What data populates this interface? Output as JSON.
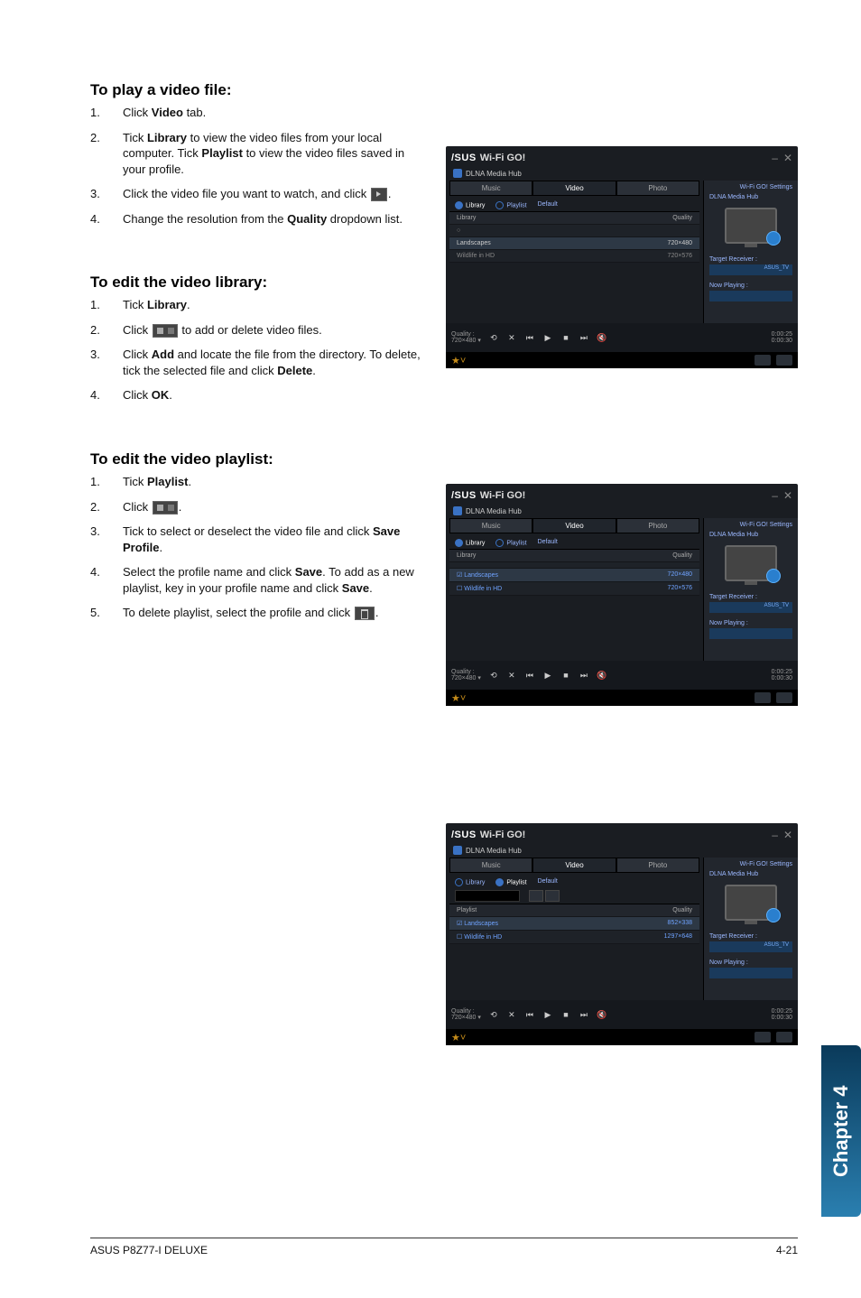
{
  "sections": {
    "play_video": {
      "title": "To play a video file:",
      "steps": [
        {
          "n": "1.",
          "t": "Click <b>Video</b> tab."
        },
        {
          "n": "2.",
          "t": "Tick <b>Library</b> to view the video files from your local computer. Tick <b>Playlist</b> to view the video files saved in your profile."
        },
        {
          "n": "3.",
          "t": "Click the video file you want to watch, and click <span class='inline-icon play' data-name='play-icon' data-interactable='false'></span>."
        },
        {
          "n": "4.",
          "t": "Change the resolution from the <b>Quality</b> dropdown list."
        }
      ]
    },
    "edit_library": {
      "title": "To edit the video library:",
      "steps": [
        {
          "n": "1.",
          "t": "Tick <b>Library</b>."
        },
        {
          "n": "2.",
          "t": "Click <span class='inline-icon wide' data-name='library-edit-icon' data-interactable='false'></span> to add or delete video files."
        },
        {
          "n": "3.",
          "t": "Click <b>Add</b> and locate the file from the directory. To delete, tick the selected file and click <b>Delete</b>."
        },
        {
          "n": "4.",
          "t": "Click <b>OK</b>."
        }
      ]
    },
    "edit_playlist": {
      "title": "To edit the video playlist:",
      "steps": [
        {
          "n": "1.",
          "t": "Tick <b>Playlist</b>."
        },
        {
          "n": "2.",
          "t": "Click <span class='inline-icon wide' data-name='playlist-edit-icon' data-interactable='false'></span>."
        },
        {
          "n": "3.",
          "t": "Tick to select or deselect the video file and click <b>Save Profile</b>."
        },
        {
          "n": "4.",
          "t": "Select the profile name and click <b>Save</b>. To add as a new playlist, key in your profile name and click <b>Save</b>."
        },
        {
          "n": "5.",
          "t": "To delete playlist, select the profile and click <span class='inline-icon trash' data-name='trash-icon' data-interactable='false'></span>."
        }
      ]
    }
  },
  "shot_common": {
    "brand": "/SUS",
    "app": "Wi-Fi GO!",
    "sub": "DLNA Media Hub",
    "settings": "Wi-Fi GO! Settings",
    "hub": "DLNA Media Hub",
    "target": "Target Receiver :",
    "target_val": "ASUS_TV",
    "now": "Now Playing :",
    "tabs": [
      "Music",
      "Video",
      "Photo"
    ],
    "subtabs": [
      "Library",
      "Playlist",
      "Default"
    ],
    "cols": [
      "Library",
      "Quality"
    ],
    "rows1": [
      {
        "l": "",
        "r": ""
      },
      {
        "l": "Landscapes",
        "r": "720×480"
      },
      {
        "l": "Wildlife in HD",
        "r": "720×576"
      }
    ],
    "quality": "Quality :",
    "qval": "720×480",
    "time1": "0:00:25",
    "time2": "0:00:30"
  },
  "shot3_extra": {
    "subtabs": [
      "Library",
      "Playlist",
      "Default"
    ],
    "rows": [
      {
        "l": "",
        "r": "Quality"
      },
      {
        "l": "Landscapes",
        "r": "852×338"
      },
      {
        "l": "Wildlife in HD",
        "r": "1297×648"
      }
    ]
  },
  "chapter": "Chapter 4",
  "footer": {
    "left": "ASUS P8Z77-I DELUXE",
    "right": "4-21"
  }
}
